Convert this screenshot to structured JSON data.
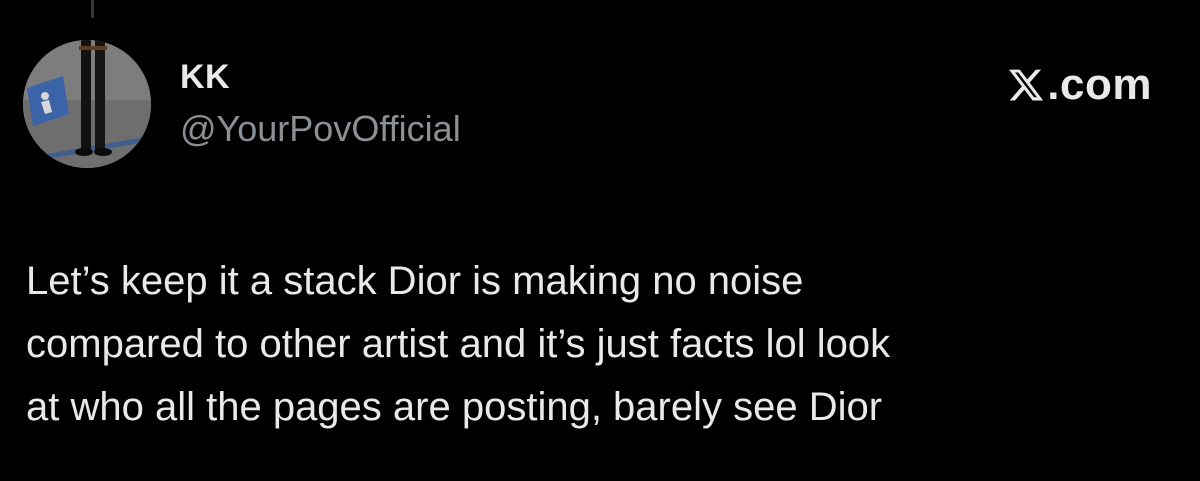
{
  "tweet": {
    "author": {
      "display_name": "KK",
      "handle": "@YourPovOfficial",
      "avatar_icon": "person-standing-avatar"
    },
    "source": {
      "logo_icon": "x-logo-icon",
      "domain": ".com"
    },
    "text_lines": [
      "Let’s keep it a stack Dior is making no noise",
      "compared to other artist and it’s just facts lol look",
      "at who all the pages are posting, barely see Dior"
    ]
  },
  "colors": {
    "background": "#000000",
    "primary_text": "#e7e9ea",
    "secondary_text": "#8b9095"
  }
}
